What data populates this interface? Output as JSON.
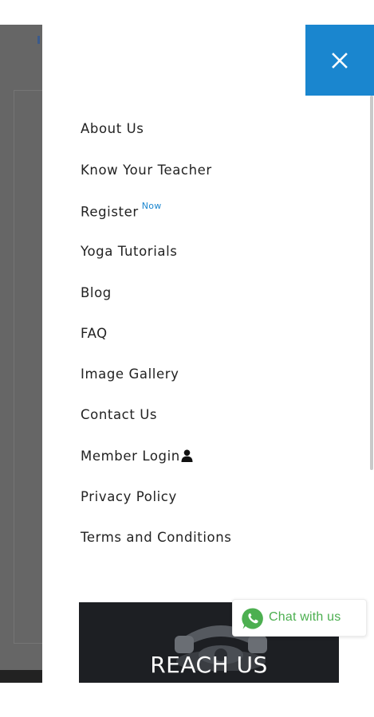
{
  "menu": {
    "items": [
      {
        "label": "About Us"
      },
      {
        "label": "Know Your Teacher"
      },
      {
        "label": "Register",
        "badge": "Now"
      },
      {
        "label": "Yoga Tutorials"
      },
      {
        "label": "Blog"
      },
      {
        "label": "FAQ"
      },
      {
        "label": "Image Gallery"
      },
      {
        "label": "Contact Us"
      },
      {
        "label": "Member Login",
        "icon": "user-icon"
      },
      {
        "label": "Privacy Policy"
      },
      {
        "label": "Terms and Conditions"
      }
    ]
  },
  "close_button": {
    "icon": "close-icon",
    "color": "#1a86cf"
  },
  "banner": {
    "title": "REACH US"
  },
  "chat": {
    "label": "Chat with us",
    "icon": "whatsapp-icon",
    "color": "#4caf50"
  }
}
